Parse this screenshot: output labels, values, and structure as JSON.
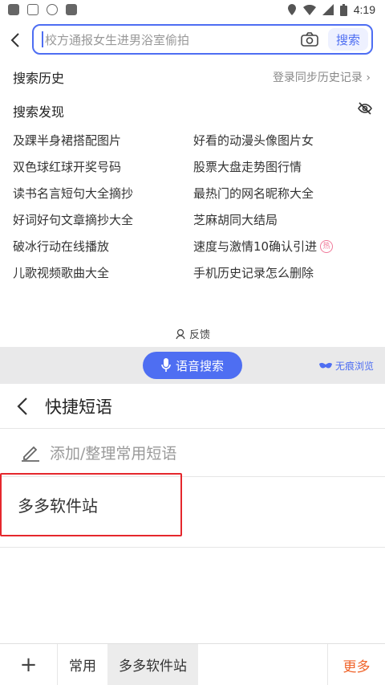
{
  "status_bar": {
    "time": "4:19"
  },
  "search": {
    "query": "校方通报女生进男浴室偷拍",
    "button_label": "搜索"
  },
  "history": {
    "title": "搜索历史",
    "sync_label": "登录同步历史记录 ›"
  },
  "discover": {
    "title": "搜索发现",
    "items": [
      [
        "及踝半身裙搭配图片",
        "好看的动漫头像图片女"
      ],
      [
        "双色球红球开奖号码",
        "股票大盘走势图行情"
      ],
      [
        "读书名言短句大全摘抄",
        "最热门的网名昵称大全"
      ],
      [
        "好词好句文章摘抄大全",
        "芝麻胡同大结局"
      ],
      [
        "破冰行动在线播放",
        "速度与激情10确认引进"
      ],
      [
        "儿歌视频歌曲大全",
        "手机历史记录怎么删除"
      ]
    ],
    "hot_badge": "热"
  },
  "feedback_label": "反馈",
  "voice_search_label": "语音搜索",
  "incognito_label": "无痕浏览",
  "phrases": {
    "title": "快捷短语",
    "add_label": "添加/整理常用短语",
    "items": [
      "多多软件站"
    ]
  },
  "bottom_bar": {
    "plus": "+",
    "tabs": [
      "常用",
      "多多软件站"
    ],
    "more_label": "更多"
  },
  "colors": {
    "accent": "#4e6ef2",
    "highlight": "#e5272d",
    "more": "#f0652c"
  }
}
